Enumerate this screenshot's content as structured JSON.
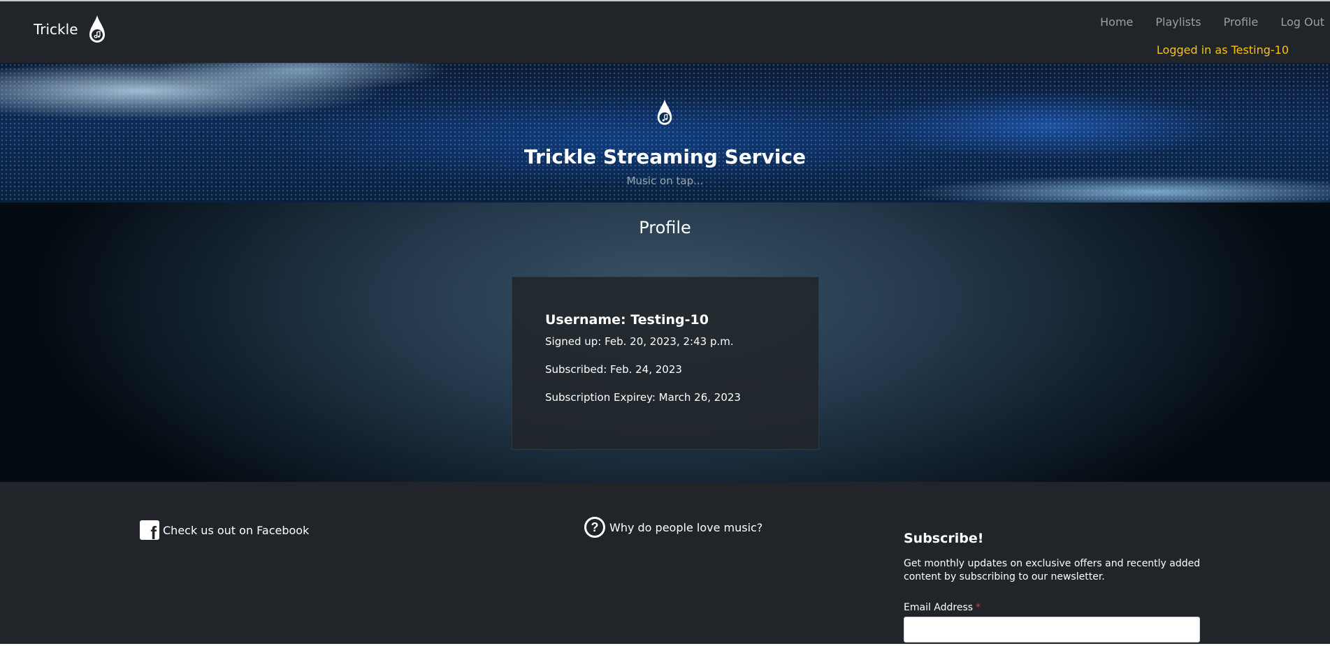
{
  "navbar": {
    "brand": "Trickle",
    "links": [
      "Home",
      "Playlists",
      "Profile",
      "Log Out"
    ],
    "login_status": "Logged in as Testing-10"
  },
  "hero": {
    "title": "Trickle Streaming Service",
    "subtitle": "Music on tap..."
  },
  "main": {
    "heading": "Profile",
    "profile": {
      "username": "Username: Testing-10",
      "signed_up": "Signed up: Feb. 20, 2023, 2:43 p.m.",
      "subscribed": "Subscribed: Feb. 24, 2023",
      "expiry": "Subscription Expirey: March 26, 2023"
    }
  },
  "footer": {
    "facebook_link": "Check us out on Facebook",
    "music_link": "Why do people love music?",
    "subscribe": {
      "heading": "Subscribe!",
      "description": "Get monthly updates on exclusive offers and recently added content by subscribing to our newsletter.",
      "email_label": "Email Address",
      "required_mark": "*",
      "email_value": ""
    }
  },
  "icons": {
    "brand_logo": "music-drop-icon",
    "facebook": "facebook-icon",
    "question": "question-circle-icon"
  },
  "colors": {
    "navbar_bg": "#212529",
    "login_status": "#ffc107",
    "required": "#dc3545"
  }
}
